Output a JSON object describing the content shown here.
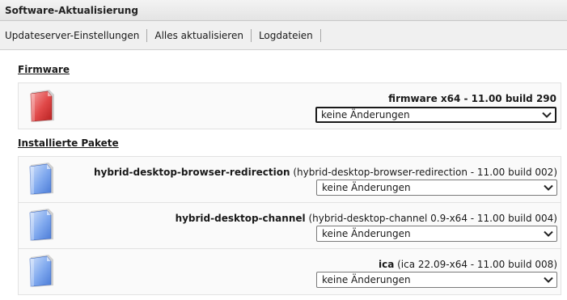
{
  "window": {
    "title": "Software-Aktualisierung"
  },
  "toolbar": {
    "items": [
      "Updateserver-Einstellungen",
      "Alles aktualisieren",
      "Logdateien"
    ]
  },
  "firmware": {
    "heading": "Firmware",
    "name": "firmware x64 - 11.00 build 290",
    "selected": "keine Änderungen",
    "icon": "red-package-icon"
  },
  "installed": {
    "heading": "Installierte Pakete",
    "packages": [
      {
        "name": "hybrid-desktop-browser-redirection",
        "detail": "(hybrid-desktop-browser-redirection - 11.00 build 002)",
        "selected": "keine Änderungen",
        "icon": "blue-package-icon"
      },
      {
        "name": "hybrid-desktop-channel",
        "detail": "(hybrid-desktop-channel 0.9-x64 - 11.00 build 004)",
        "selected": "keine Änderungen",
        "icon": "blue-package-icon"
      },
      {
        "name": "ica",
        "detail": "(ica 22.09-x64 - 11.00 build 008)",
        "selected": "keine Änderungen",
        "icon": "blue-package-icon"
      }
    ]
  },
  "colors": {
    "firmware_icon": "#e04848",
    "package_icon": "#5b8fe6",
    "accent": "#1a1a1a"
  }
}
